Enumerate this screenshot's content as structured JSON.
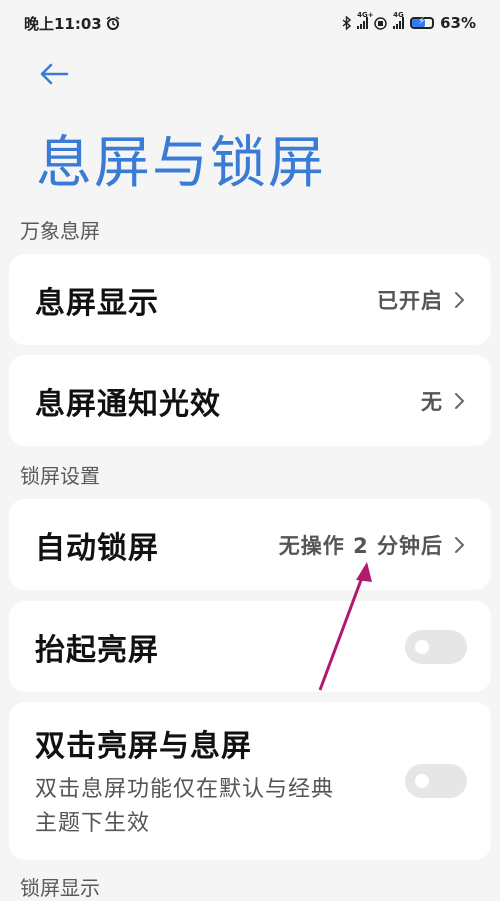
{
  "status_bar": {
    "time": "晚上11:03",
    "alarm_icon": "alarm-icon",
    "bluetooth_icon": "bluetooth-icon",
    "sim1_network": "4G+",
    "sim2_network": "4G",
    "hd_icon": "hd-voice-icon",
    "battery_level": "63%"
  },
  "header": {
    "back_icon": "back-arrow-icon",
    "title": "息屏与锁屏"
  },
  "sections": {
    "always_on": {
      "label": "万象息屏",
      "items": [
        {
          "title": "息屏显示",
          "value": "已开启"
        },
        {
          "title": "息屏通知光效",
          "value": "无"
        }
      ]
    },
    "lock_screen": {
      "label": "锁屏设置",
      "items": [
        {
          "title": "自动锁屏",
          "value": "无操作 2 分钟后"
        },
        {
          "title": "抬起亮屏",
          "toggle_on": false
        },
        {
          "title": "双击亮屏与息屏",
          "subtitle_line1": "双击息屏功能仅在默认与经典",
          "subtitle_line2": "主题下生效",
          "toggle_on": false
        }
      ]
    },
    "lock_display": {
      "label": "锁屏显示"
    }
  },
  "colors": {
    "accent": "#3a7bd5",
    "background": "#f5f5f5",
    "card": "#ffffff",
    "annotation_arrow": "#b0196e"
  }
}
